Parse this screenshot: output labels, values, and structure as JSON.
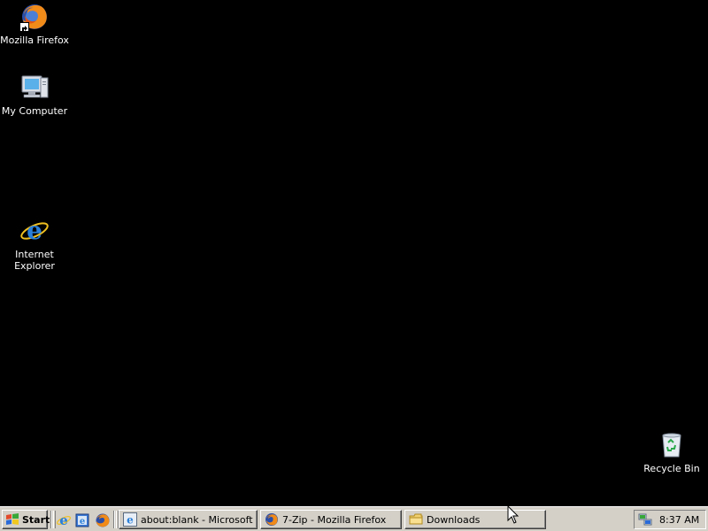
{
  "desktop": {
    "icons": [
      {
        "label": "Mozilla Firefox",
        "icon": "firefox-icon"
      },
      {
        "label": "My Computer",
        "icon": "computer-icon"
      },
      {
        "label": "Internet\nExplorer",
        "icon": "ie-icon"
      },
      {
        "label": "Recycle Bin",
        "icon": "recycle-bin-icon"
      }
    ]
  },
  "taskbar": {
    "start_label": "Start",
    "quick_launch": [
      "ie-icon",
      "show-desktop-icon",
      "firefox-icon"
    ],
    "tasks": [
      {
        "label": "about:blank - Microsoft I...",
        "icon": "ie-icon"
      },
      {
        "label": "7-Zip - Mozilla Firefox",
        "icon": "firefox-icon"
      },
      {
        "label": "Downloads",
        "icon": "folder-icon"
      }
    ],
    "tray": {
      "clock": "8:37 AM",
      "icon": "network-icon"
    }
  },
  "colors": {
    "desktop_bg": "#000000",
    "taskbar_bg": "#d4d0c8"
  }
}
